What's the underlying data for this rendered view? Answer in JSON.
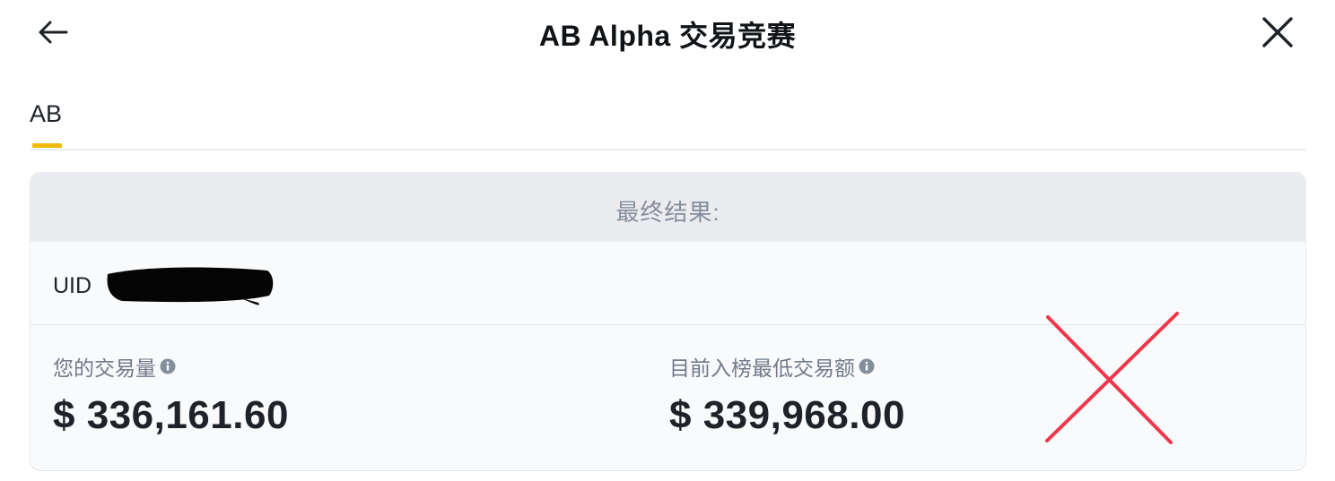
{
  "header": {
    "title": "AB Alpha 交易竞赛",
    "back_icon": "arrow-left-icon",
    "close_icon": "close-icon"
  },
  "tabs": [
    {
      "label": "AB",
      "active": true
    }
  ],
  "card": {
    "heading": "最终结果:",
    "uid_label": "UID",
    "volume_label": "您的交易量",
    "volume_value": "$ 336,161.60",
    "min_label": "目前入榜最低交易额",
    "min_value": "$ 339,968.00"
  },
  "colors": {
    "accent": "#f0b90b",
    "cross_mark": "#f0364a"
  }
}
